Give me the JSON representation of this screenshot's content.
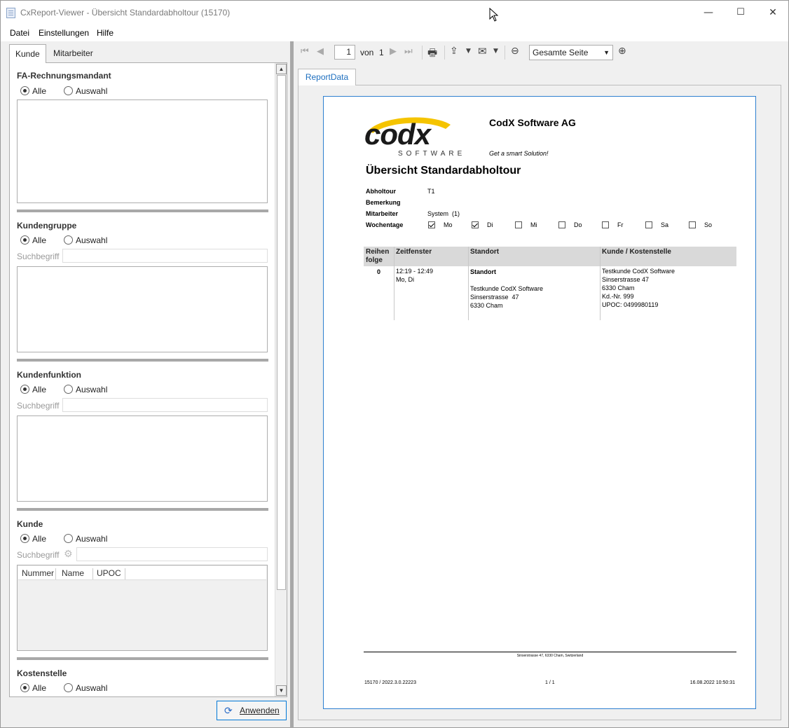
{
  "window": {
    "title": "CxReport-Viewer - Übersicht Standardabholtour (15170)",
    "min": "—",
    "max": "☐",
    "close": "✕"
  },
  "menu": [
    "Datei",
    "Einstellungen",
    "Hilfe"
  ],
  "left": {
    "tabs": [
      "Kunde",
      "Mitarbeiter"
    ],
    "sections": {
      "fa": {
        "title": "FA-Rechnungsmandant",
        "all": "Alle",
        "sel": "Auswahl"
      },
      "kgruppe": {
        "title": "Kundengruppe",
        "all": "Alle",
        "sel": "Auswahl",
        "search": "Suchbegriff"
      },
      "kfunktion": {
        "title": "Kundenfunktion",
        "all": "Alle",
        "sel": "Auswahl",
        "search": "Suchbegriff"
      },
      "kunde": {
        "title": "Kunde",
        "all": "Alle",
        "sel": "Auswahl",
        "search": "Suchbegriff",
        "columns": [
          "Nummer",
          "Name",
          "UPOC"
        ]
      },
      "kst": {
        "title": "Kostenstelle",
        "all": "Alle",
        "sel": "Auswahl"
      }
    },
    "apply": "Anwenden"
  },
  "toolbar": {
    "page": "1",
    "of": "von",
    "total": "1",
    "zoom": "Gesamte Seite"
  },
  "report_tab": "ReportData",
  "report": {
    "logo": "codx",
    "logo_sub": "SOFTWARE",
    "company": "CodX Software AG",
    "slogan": "Get a smart Solution!",
    "title": "Übersicht Standardabholtour",
    "fields": {
      "abholtour_label": "Abholtour",
      "abholtour_value": "T1",
      "bemerkung_label": "Bemerkung",
      "mitarbeiter_label": "Mitarbeiter",
      "mitarbeiter_value": "System  (1)",
      "wochentage_label": "Wochentage"
    },
    "days": [
      {
        "label": "Mo",
        "checked": true
      },
      {
        "label": "Di",
        "checked": true
      },
      {
        "label": "Mi",
        "checked": false
      },
      {
        "label": "Do",
        "checked": false
      },
      {
        "label": "Fr",
        "checked": false
      },
      {
        "label": "Sa",
        "checked": false
      },
      {
        "label": "So",
        "checked": false
      }
    ],
    "table": {
      "headers": [
        "Reihen\nfolge",
        "Zeitfenster",
        "Standort",
        "Kunde / Kostenstelle"
      ],
      "row": {
        "folge": "0",
        "zeit1": "12:19 - 12:49",
        "zeit2": "Mo, Di",
        "standort_title": "Standort",
        "standort1": "Testkunde CodX Software",
        "standort2": "Sinserstrasse  47",
        "standort3": "6330 Cham",
        "kunde1": "Testkunde CodX Software",
        "kunde2": "Sinserstrasse 47",
        "kunde3": "6330 Cham",
        "kunde4": "Kd.-Nr. 999",
        "kunde5": "UPOC: 0499980119"
      }
    },
    "footer_address": "Sinserstrasse 47,  6330 Cham,  Switzerland",
    "footer_left": "15170 / 2022.3.0.22223",
    "footer_center": "1 / 1",
    "footer_right": "16.08.2022 10:50:31"
  },
  "colors": {
    "accent": "#0078d7",
    "logo_yellow": "#f5c400"
  }
}
